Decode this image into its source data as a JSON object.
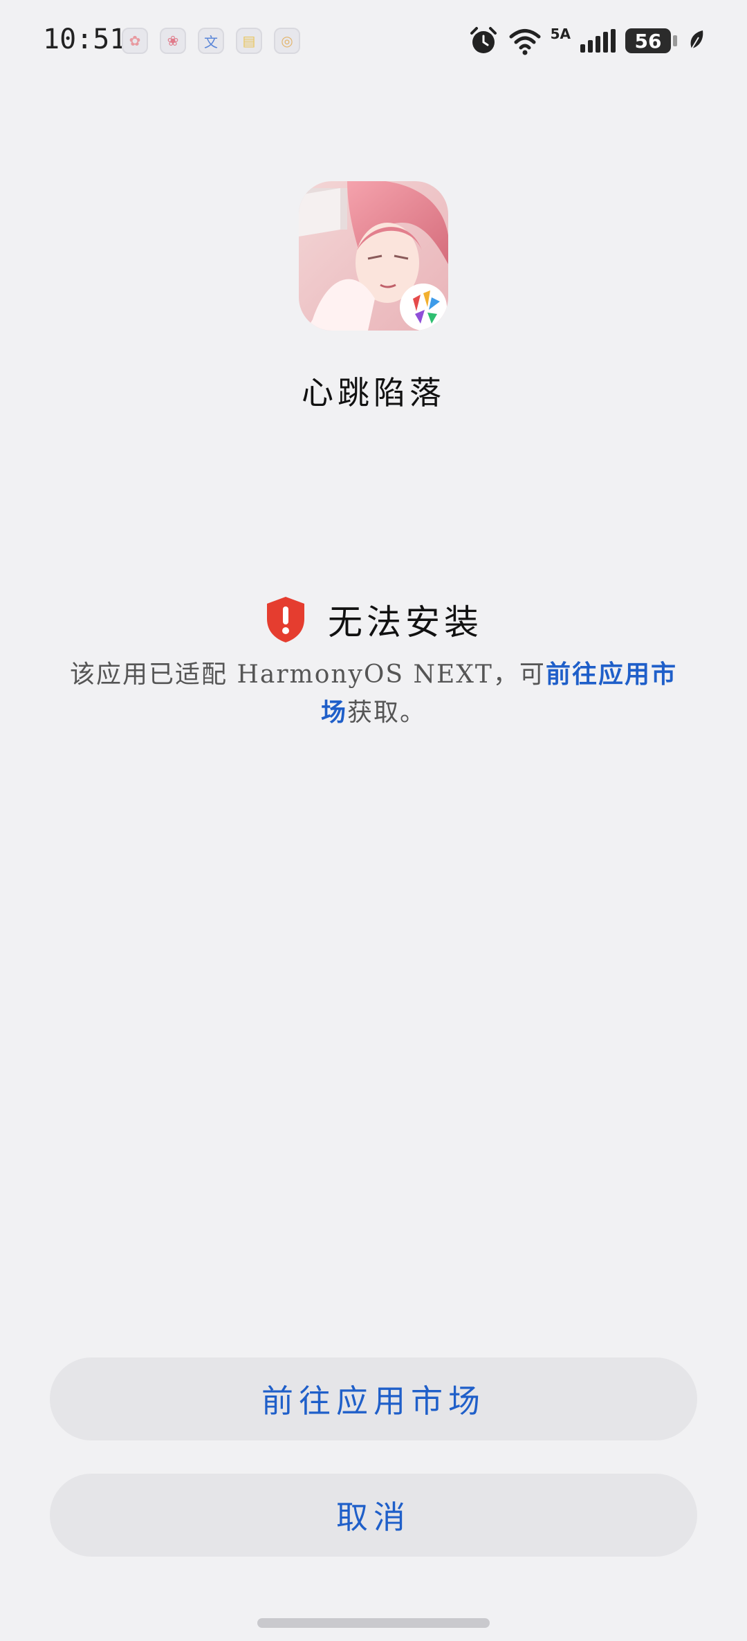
{
  "status_bar": {
    "time": "10:51",
    "notification_icons": [
      "app-notification-icon-1",
      "app-notification-icon-2",
      "translate-notification-icon",
      "notes-notification-icon",
      "app-notification-icon-5"
    ],
    "network_type": "5A",
    "battery_level": "56",
    "icons": [
      "alarm-icon",
      "wifi-icon",
      "signal-icon",
      "battery-icon",
      "eco-leaf-icon"
    ]
  },
  "app": {
    "name": "心跳陷落",
    "icon": "app-icon"
  },
  "warning": {
    "icon": "shield-exclamation-icon",
    "title": "无法安装",
    "description_prefix": "该应用已适配 HarmonyOS NEXT，可",
    "link_text": "前往应用市场",
    "description_suffix": "获取。"
  },
  "buttons": {
    "market_label": "前往应用市场",
    "cancel_label": "取消"
  },
  "colors": {
    "background": "#f1f1f3",
    "accent": "#1f5fc9",
    "warning": "#e53d2f",
    "button_bg": "#e5e5e8"
  }
}
